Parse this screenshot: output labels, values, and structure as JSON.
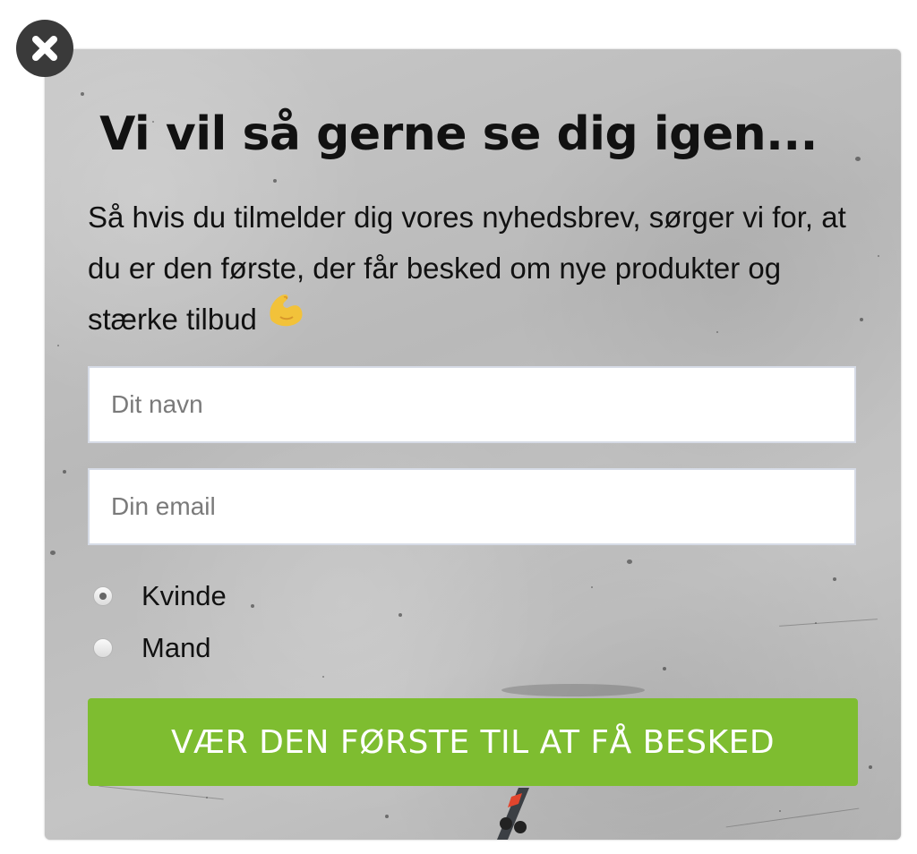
{
  "popup": {
    "title": "Vi vil så gerne se dig igen...",
    "intro_text": "Så hvis du tilmelder dig vores nyhedsbrev, sørger vi for, at du er den første, der får besked om nye produkter og stærke tilbud",
    "intro_emoji": "flexed-biceps-icon",
    "close_icon": "close-icon",
    "fields": {
      "name_placeholder": "Dit navn",
      "name_value": "",
      "email_placeholder": "Din email",
      "email_value": ""
    },
    "gender_options": [
      {
        "label": "Kvinde",
        "selected": true
      },
      {
        "label": "Mand",
        "selected": false
      }
    ],
    "submit_label": "VÆR DEN FØRSTE TIL AT FÅ BESKED",
    "colors": {
      "accent": "#7ebd30",
      "close_bg": "#3a3a3a",
      "background": "#bdbdbd",
      "text": "#111111"
    }
  }
}
